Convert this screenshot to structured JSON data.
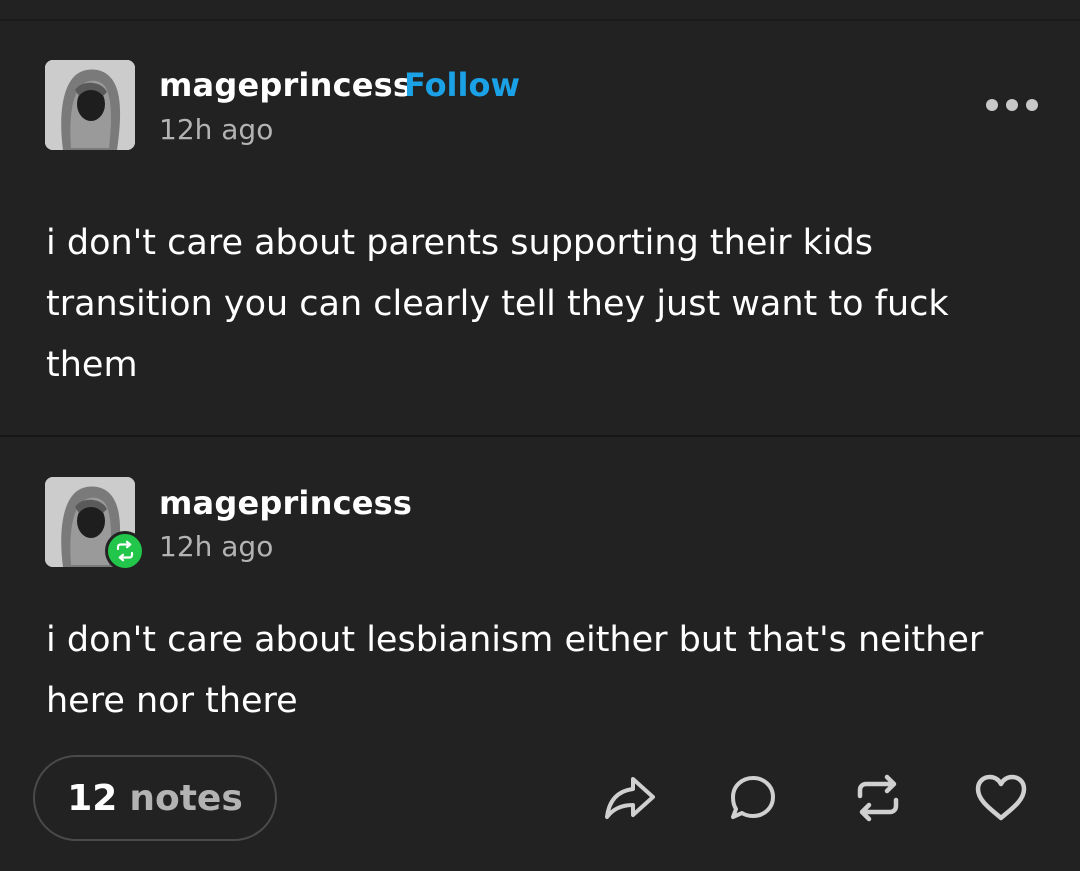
{
  "posts": [
    {
      "username": "mageprincess",
      "follow_label": "Follow",
      "timestamp": "12h ago",
      "body": "i don't care about parents supporting their kids transition you can clearly tell they just want to fuck them"
    },
    {
      "username": "mageprincess",
      "timestamp": "12h ago",
      "badge": "reblog-icon",
      "body": "i don't care about lesbianism either but that's neither here nor there"
    }
  ],
  "footer": {
    "notes_count": "12",
    "notes_label": "notes",
    "actions": [
      "share-icon",
      "reply-icon",
      "reblog-icon",
      "like-icon"
    ]
  },
  "colors": {
    "background": "#222222",
    "follow": "#1aa1e6",
    "reblog_badge": "#21c64a",
    "muted_text": "#b3b3b3"
  }
}
